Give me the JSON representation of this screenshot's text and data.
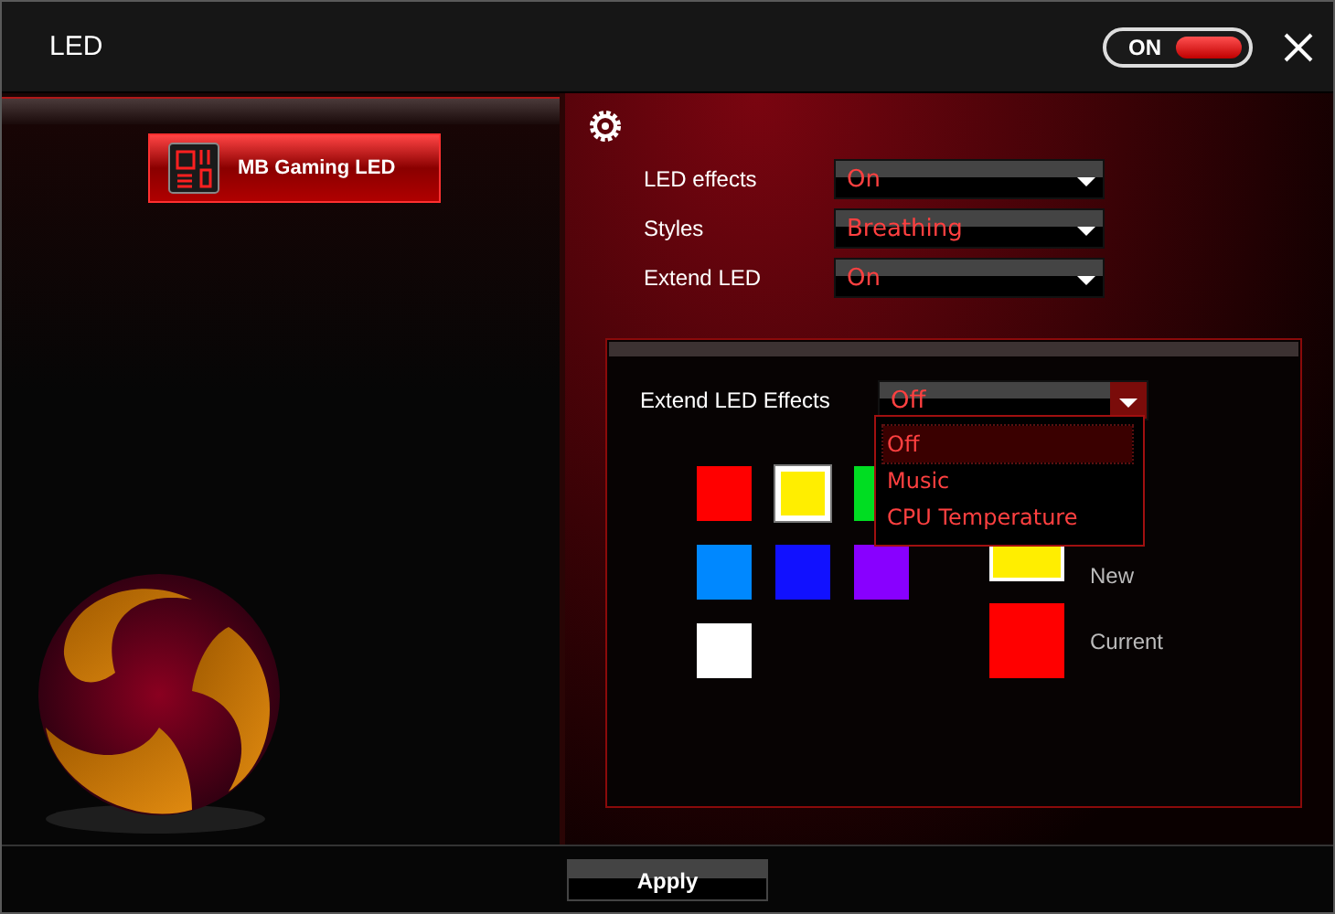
{
  "window": {
    "title": "LED",
    "power_toggle": {
      "label": "ON",
      "on": true
    }
  },
  "sidebar": {
    "items": [
      {
        "label": "MB Gaming LED",
        "selected": true
      }
    ]
  },
  "settings": [
    {
      "label": "LED effects",
      "value": "On"
    },
    {
      "label": "Styles",
      "value": "Breathing"
    },
    {
      "label": "Extend LED",
      "value": "On"
    }
  ],
  "extend_panel": {
    "label": "Extend LED Effects",
    "value": "Off",
    "expanded": true,
    "options": [
      {
        "label": "Off",
        "selected": true
      },
      {
        "label": "Music",
        "selected": false
      },
      {
        "label": "CPU Temperature",
        "selected": false
      }
    ],
    "swatches": [
      {
        "color": "#ff0000",
        "selected": false
      },
      {
        "color": "#ffee00",
        "selected": true
      },
      {
        "color": "#00dd22",
        "selected": false
      },
      {
        "color": "#0088ff",
        "selected": false
      },
      {
        "color": "#1111ff",
        "selected": false
      },
      {
        "color": "#8800ff",
        "selected": false
      },
      {
        "color": "#ffffff",
        "selected": false
      }
    ],
    "new_color": {
      "label": "New",
      "color": "#ffee00"
    },
    "current_color": {
      "label": "Current",
      "color": "#ff0000"
    }
  },
  "buttons": [
    {
      "label": "Apply"
    }
  ]
}
